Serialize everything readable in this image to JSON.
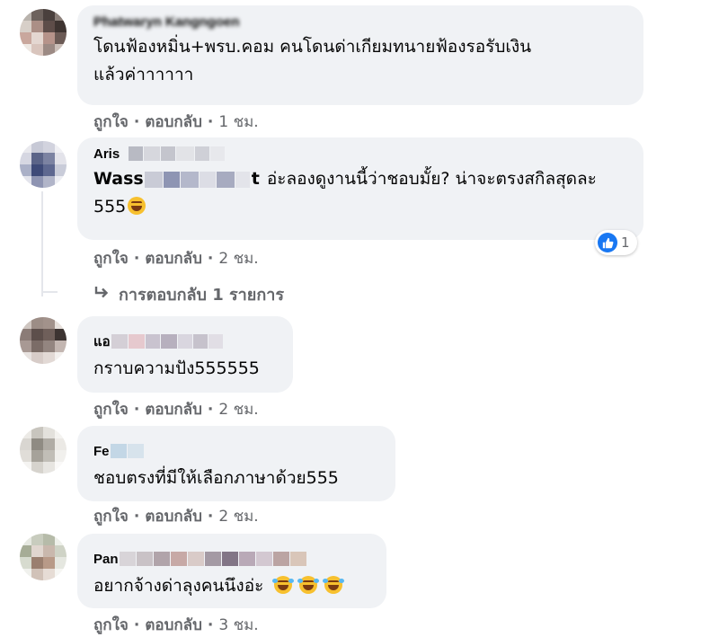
{
  "comments": [
    {
      "author": "Phatwaryn Kangngoen",
      "text_lines": [
        "โดนฟ้องหมิ่น+พรบ.คอม คนโดนด่าเกียมทนายฟ้องรอรับเงิน",
        "แล้วค่าาาาาา"
      ],
      "like_label": "ถูกใจ",
      "reply_label": "ตอบกลับ",
      "time": "1 ชม."
    },
    {
      "author": "Aris",
      "mention_start": "Wass",
      "mention_end": "t",
      "text_rest": "อ่ะลองดูงานนี้ว่าชอบมั้ย? น่าจะตรงสกิลสุดละ",
      "text_line2": "555",
      "like_label": "ถูกใจ",
      "reply_label": "ตอบกลับ",
      "time": "2 ชม.",
      "reaction_count": "1",
      "replies_label": "การตอบกลับ 1 รายการ"
    },
    {
      "author": "แอ",
      "text": "กราบความปัง555555",
      "like_label": "ถูกใจ",
      "reply_label": "ตอบกลับ",
      "time": "2 ชม."
    },
    {
      "author": "Fe",
      "text": "ชอบตรงที่มีให้เลือกภาษาด้วย555",
      "like_label": "ถูกใจ",
      "reply_label": "ตอบกลับ",
      "time": "2 ชม."
    },
    {
      "author": "Pan",
      "text": "อยากจ้างด่าลุงคนนึงอ่ะ",
      "like_label": "ถูกใจ",
      "reply_label": "ตอบกลับ",
      "time": "3 ชม."
    }
  ],
  "colors": {
    "bubble": "#f0f2f5",
    "meta_text": "#65676b",
    "like_blue": "#1877f2"
  },
  "icons": [
    "reply-arrow-icon",
    "like-reaction-icon",
    "laughing-emoji-icon",
    "rofl-emoji-icon"
  ]
}
